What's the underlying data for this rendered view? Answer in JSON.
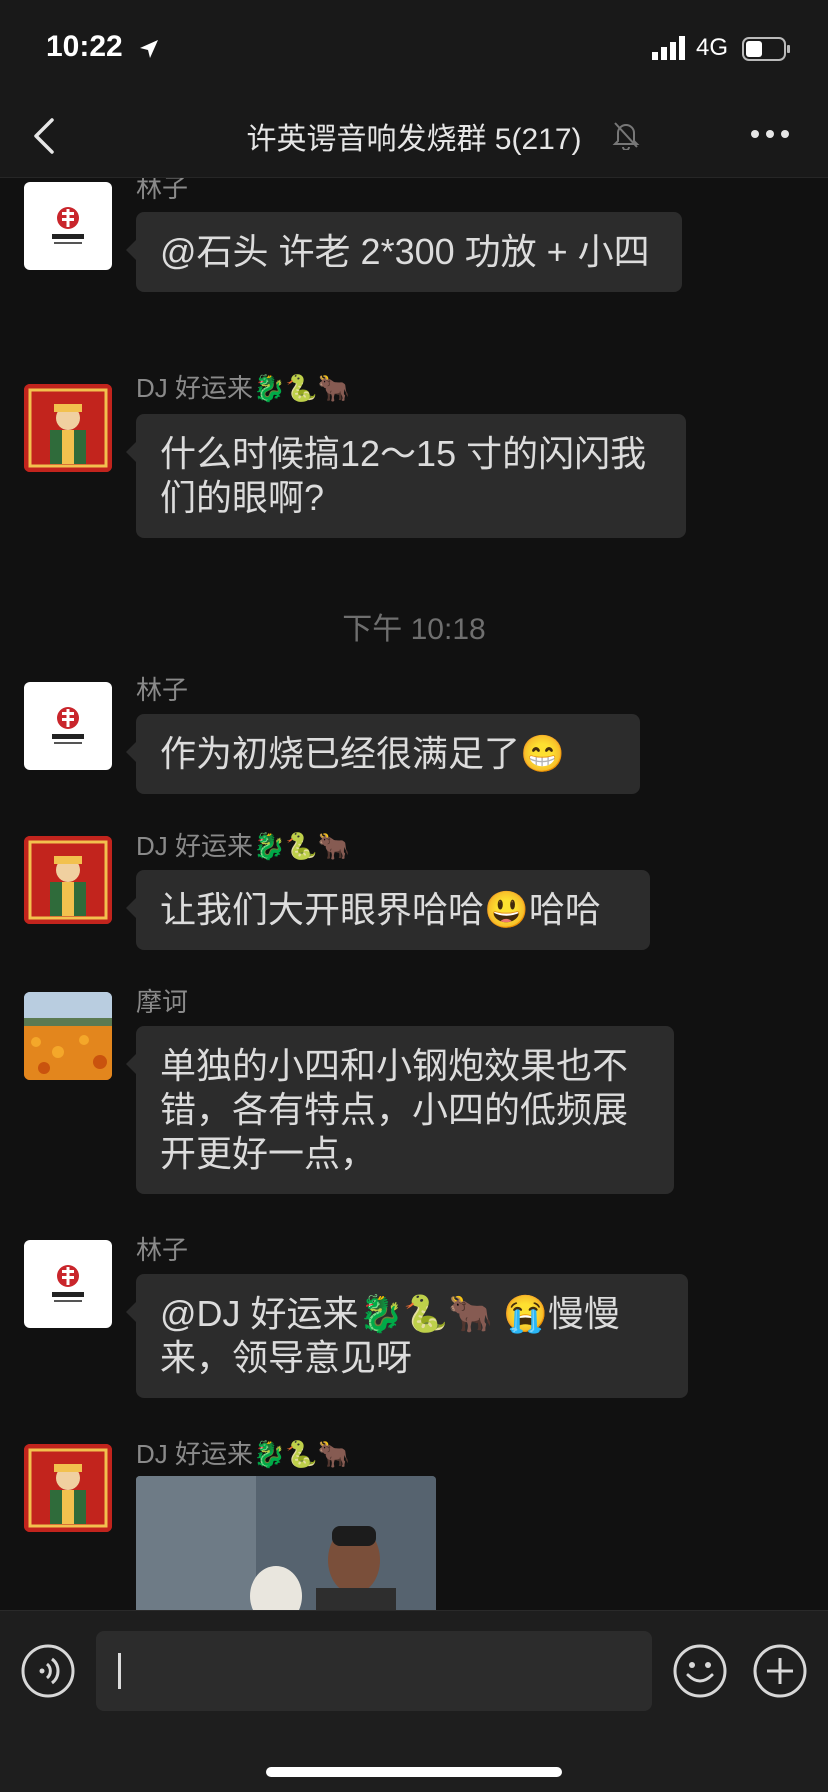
{
  "status_bar": {
    "time": "10:22",
    "network": "4G"
  },
  "nav": {
    "title": "许英谔音响发烧群 5(217)"
  },
  "messages": [
    {
      "sender": "林子",
      "text": "@石头 许老 2*300 功放 + 小四"
    },
    {
      "sender": "DJ 好运来🐉🐍🐂",
      "text": "什么时候搞12～15 寸的闪闪我们的眼啊?"
    },
    {
      "sender": "林子",
      "text": "作为初烧已经很满足了😁"
    },
    {
      "sender": "DJ 好运来🐉🐍🐂",
      "text": "让我们大开眼界哈哈😃哈哈"
    },
    {
      "sender": "摩诃",
      "text": "单独的小四和小钢炮效果也不错，各有特点，小四的低频展开更好一点，"
    },
    {
      "sender": "林子",
      "text": "@DJ 好运来🐉🐍🐂 😭慢慢来，领导意见呀"
    },
    {
      "sender": "DJ 好运来🐉🐍🐂",
      "text": ""
    }
  ],
  "timestamp": "下午 10:18",
  "input": {
    "value": ""
  },
  "icons": {
    "back": "back-chevron-icon",
    "mute": "bell-slash-icon",
    "more": "more-dots-icon",
    "voice": "voice-icon",
    "emoji": "emoji-icon",
    "add": "plus-icon"
  },
  "colors": {
    "background": "#111111",
    "bubble": "#2c2c2c",
    "text": "#dcdcdc",
    "secondary": "#8a8a8a"
  }
}
